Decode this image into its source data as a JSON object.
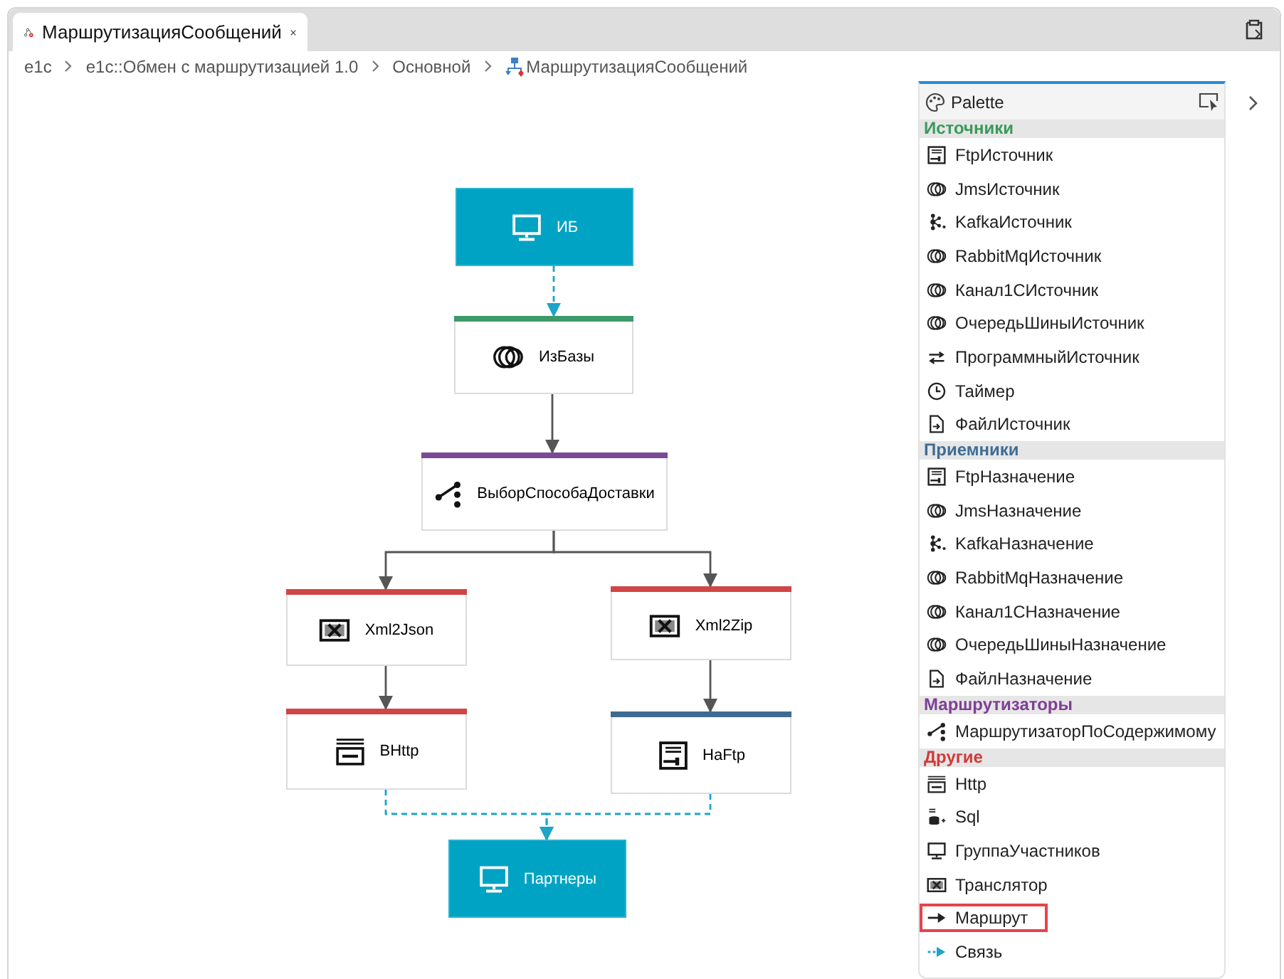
{
  "tab": {
    "title": "МаршрутизацияСообщений"
  },
  "breadcrumb": [
    "e1c",
    "e1c::Обмен с маршрутизацией 1.0",
    "Основной",
    "МаршрутизацияСообщений"
  ],
  "diagram": {
    "nodes": [
      {
        "label": "ИБ",
        "kind": "endpoint"
      },
      {
        "label": "ИзБазы",
        "kind": "source",
        "color": "#3d9a6a",
        "incoming_dashed": true
      },
      {
        "label": "ВыборСпособаДоставки",
        "kind": "router",
        "color": "#7b4a94",
        "incoming_dashed": false
      },
      {
        "label": "Xml2Json",
        "kind": "translator",
        "color": "#d04545",
        "incoming_dashed": false
      },
      {
        "label": "Xml2Zip",
        "kind": "translator",
        "color": "#d04545",
        "incoming_dashed": false
      },
      {
        "label": "ВHttp",
        "kind": "http",
        "color": "#d04545",
        "incoming_dashed": false
      },
      {
        "label": "НаFtp",
        "kind": "ftp",
        "color": "#3f6a92",
        "incoming_dashed": false
      },
      {
        "label": "Партнеры",
        "kind": "endpoint",
        "incoming_dashed": true
      }
    ]
  },
  "palette": {
    "title": "Palette",
    "sections": [
      {
        "title": "Источники",
        "color": "#3a9a5b",
        "items": [
          {
            "label": "FtpИсточник",
            "kind": "ftp",
            "selected": false
          },
          {
            "label": "JmsИсточник",
            "kind": "rings",
            "selected": false
          },
          {
            "label": "KafkaИсточник",
            "kind": "kafka",
            "selected": false
          },
          {
            "label": "RabbitMqИсточник",
            "kind": "rings",
            "selected": false
          },
          {
            "label": "Канал1СИсточник",
            "kind": "rings",
            "selected": false
          },
          {
            "label": "ОчередьШиныИсточник",
            "kind": "rings",
            "selected": false
          },
          {
            "label": "ПрограммныйИсточник",
            "kind": "program",
            "selected": false
          },
          {
            "label": "Таймер",
            "kind": "timer",
            "selected": false
          },
          {
            "label": "ФайлИсточник",
            "kind": "file",
            "selected": false
          }
        ]
      },
      {
        "title": "Приемники",
        "color": "#3f6d94",
        "items": [
          {
            "label": "FtpНазначение",
            "kind": "ftp",
            "selected": false
          },
          {
            "label": "JmsНазначение",
            "kind": "rings",
            "selected": false
          },
          {
            "label": "KafkaНазначение",
            "kind": "kafka",
            "selected": false
          },
          {
            "label": "RabbitMqНазначение",
            "kind": "rings",
            "selected": false
          },
          {
            "label": "Канал1СНазначение",
            "kind": "rings",
            "selected": false
          },
          {
            "label": "ОчередьШиныНазначение",
            "kind": "rings",
            "selected": false
          },
          {
            "label": "ФайлНазначение",
            "kind": "file",
            "selected": false
          }
        ]
      },
      {
        "title": "Маршрутизаторы",
        "color": "#7e3f96",
        "items": [
          {
            "label": "МаршрутизаторПоСодержимому",
            "kind": "router",
            "selected": false
          }
        ]
      },
      {
        "title": "Другие",
        "color": "#d33a3a",
        "items": [
          {
            "label": "Http",
            "kind": "http",
            "selected": false
          },
          {
            "label": "Sql",
            "kind": "sql",
            "selected": false
          },
          {
            "label": "ГруппаУчастников",
            "kind": "monitor",
            "selected": false
          },
          {
            "label": "Транслятор",
            "kind": "translator",
            "selected": false
          },
          {
            "label": "Маршрут",
            "kind": "route",
            "selected": true
          },
          {
            "label": "Связь",
            "kind": "link",
            "selected": false
          }
        ]
      }
    ]
  }
}
